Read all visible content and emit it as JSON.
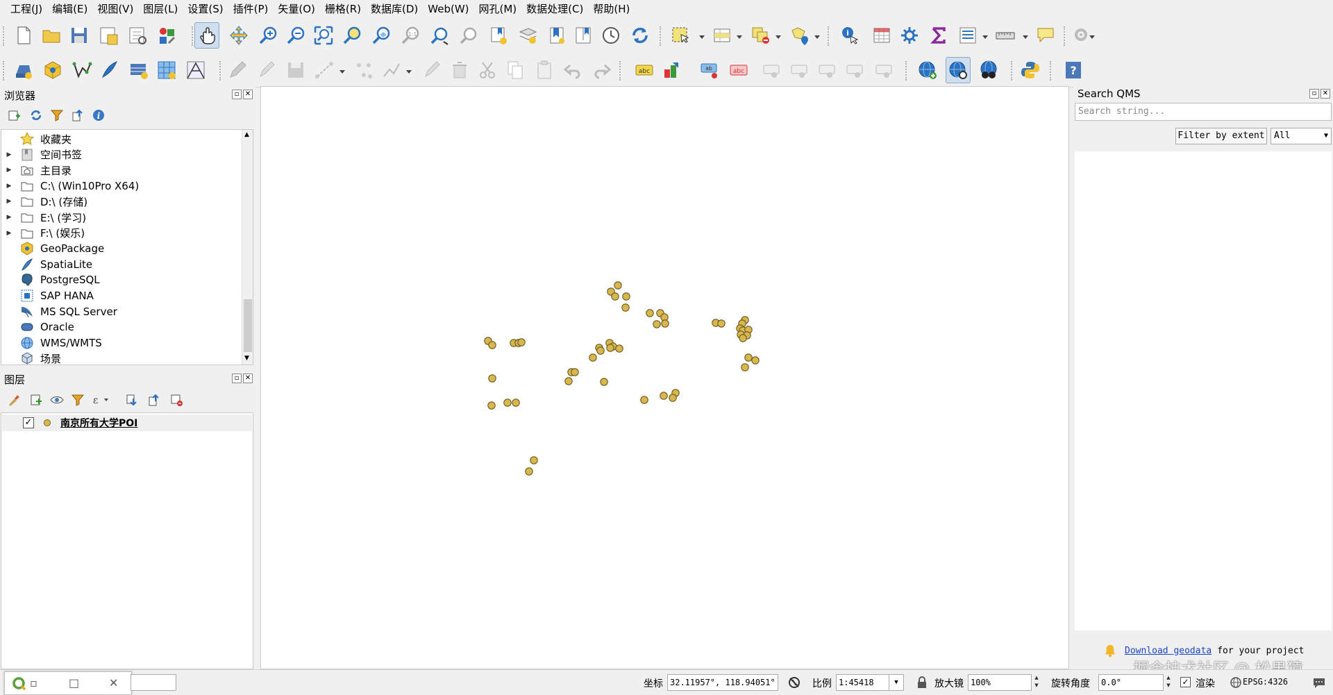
{
  "menu": [
    "工程(J)",
    "编辑(E)",
    "视图(V)",
    "图层(L)",
    "设置(S)",
    "插件(P)",
    "矢量(O)",
    "栅格(R)",
    "数据库(D)",
    "Web(W)",
    "网孔(M)",
    "数据处理(C)",
    "帮助(H)"
  ],
  "browser_panel": {
    "title": "浏览器",
    "items": [
      {
        "label": "收藏夹",
        "icon": "star-icon",
        "expandable": false
      },
      {
        "label": "空间书签",
        "icon": "bookmark-icon",
        "expandable": true
      },
      {
        "label": "主目录",
        "icon": "home-folder-icon",
        "expandable": true
      },
      {
        "label": "C:\\ (Win10Pro X64)",
        "icon": "folder-icon",
        "expandable": true
      },
      {
        "label": "D:\\ (存储)",
        "icon": "folder-icon",
        "expandable": true
      },
      {
        "label": "E:\\ (学习)",
        "icon": "folder-icon",
        "expandable": true
      },
      {
        "label": "F:\\ (娱乐)",
        "icon": "folder-icon",
        "expandable": true
      },
      {
        "label": "GeoPackage",
        "icon": "geopackage-icon",
        "expandable": false
      },
      {
        "label": "SpatiaLite",
        "icon": "spatialite-icon",
        "expandable": false
      },
      {
        "label": "PostgreSQL",
        "icon": "postgresql-icon",
        "expandable": false
      },
      {
        "label": "SAP HANA",
        "icon": "sap-hana-icon",
        "expandable": false
      },
      {
        "label": "MS SQL Server",
        "icon": "mssql-icon",
        "expandable": false
      },
      {
        "label": "Oracle",
        "icon": "oracle-icon",
        "expandable": false
      },
      {
        "label": "WMS/WMTS",
        "icon": "wms-icon",
        "expandable": false
      },
      {
        "label": "场景",
        "icon": "scene-icon",
        "expandable": false
      }
    ]
  },
  "layers_panel": {
    "title": "图层",
    "layers": [
      {
        "name": "南京所有大学POI",
        "checked": true,
        "symbol_color": "#d8b84e"
      }
    ]
  },
  "qms_panel": {
    "title": "Search QMS",
    "search_placeholder": "Search string...",
    "filter_button": "Filter by extent",
    "filter_select": "All",
    "footer_link": "Download geodata",
    "footer_text": "for your project"
  },
  "map": {
    "point_color": "#d8b84e",
    "point_stroke": "#6b5a1e"
  },
  "statusbar": {
    "coord_label": "坐标",
    "coord_value": "32.11957°,  118.94051°",
    "scale_label": "比例",
    "scale_value": "1:45418",
    "magnifier_label": "放大镜",
    "magnifier_value": "100%",
    "rotation_label": "旋转角度",
    "rotation_value": "0.0°",
    "render_label": "渲染",
    "render_checked": true,
    "crs": "EPSG:4326"
  },
  "watermark": "掘金技术社区 @ 松果猿"
}
